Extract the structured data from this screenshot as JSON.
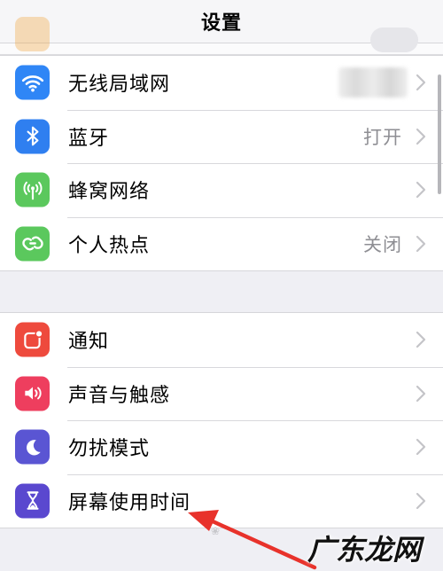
{
  "nav": {
    "title": "设置"
  },
  "group1": [
    {
      "id": "wifi",
      "label": "无线局域网",
      "value": "",
      "icon": "wifi-icon",
      "color": "#2f86f6",
      "blurred_value": true
    },
    {
      "id": "bluetooth",
      "label": "蓝牙",
      "value": "打开",
      "icon": "bluetooth-icon",
      "color": "#2f7ff0"
    },
    {
      "id": "cellular",
      "label": "蜂窝网络",
      "value": "",
      "icon": "antenna-icon",
      "color": "#5bc85d"
    },
    {
      "id": "hotspot",
      "label": "个人热点",
      "value": "关闭",
      "icon": "hotspot-link-icon",
      "color": "#5bc85d"
    }
  ],
  "group2": [
    {
      "id": "notifications",
      "label": "通知",
      "value": "",
      "icon": "notification-icon",
      "color": "#ee4a3d"
    },
    {
      "id": "sounds",
      "label": "声音与触感",
      "value": "",
      "icon": "speaker-icon",
      "color": "#ee3e5e"
    },
    {
      "id": "dnd",
      "label": "勿扰模式",
      "value": "",
      "icon": "moon-icon",
      "color": "#5a55d3"
    },
    {
      "id": "screentime",
      "label": "屏幕使用时间",
      "value": "",
      "icon": "hourglass-icon",
      "color": "#5a48cf"
    }
  ],
  "annotation": {
    "arrow_color": "#e8322b"
  },
  "watermark": {
    "text": "广东龙网"
  }
}
